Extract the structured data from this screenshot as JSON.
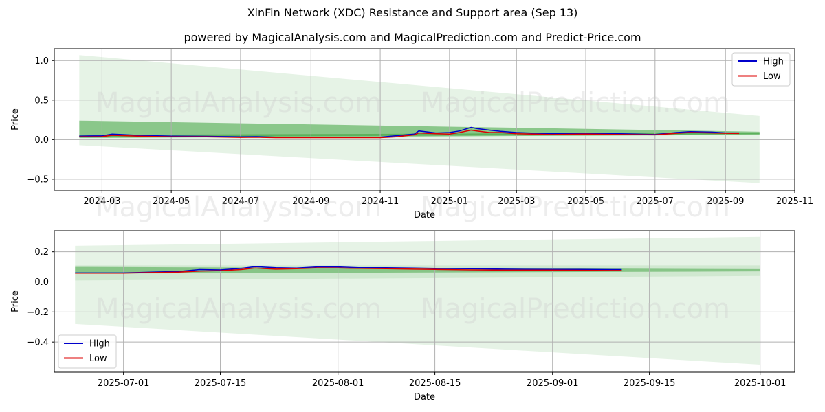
{
  "header": {
    "title": "XinFin Network (XDC) Resistance and Support area (Sep 13)",
    "subtitle": "powered by MagicalAnalysis.com and MagicalPrediction.com and Predict-Price.com"
  },
  "watermark": [
    "MagicalAnalysis.com",
    "MagicalPrediction.com"
  ],
  "colors": {
    "high": "#0000cc",
    "low": "#dd0000",
    "band": "#2e9b2e"
  },
  "chart_data": [
    {
      "type": "line",
      "xlabel": "Date",
      "ylabel": "Price",
      "x_tick_labels": [
        "2024-03",
        "2024-05",
        "2024-07",
        "2024-09",
        "2024-11",
        "2025-01",
        "2025-03",
        "2025-05",
        "2025-07",
        "2025-09",
        "2025-11"
      ],
      "x_tick_dates": [
        "2024-03-01",
        "2024-05-01",
        "2024-07-01",
        "2024-09-01",
        "2024-11-01",
        "2025-01-01",
        "2025-03-01",
        "2025-05-01",
        "2025-07-01",
        "2025-09-01",
        "2025-11-01"
      ],
      "y_ticks": [
        1.0,
        0.5,
        0.0,
        -0.5
      ],
      "y_tick_labels": [
        "1.0",
        "0.5",
        "0.0",
        "−0.5"
      ],
      "xlim": [
        "2024-01-19",
        "2025-11-01"
      ],
      "ylim": [
        -0.64,
        1.15
      ],
      "grid": true,
      "legend": {
        "position": "top-right",
        "entries": [
          "High",
          "Low"
        ]
      },
      "bands": [
        {
          "start": "2024-02-10",
          "end": "2025-10-01",
          "upper": [
            1.07,
            0.3
          ],
          "lower": [
            -0.07,
            -0.55
          ],
          "opacity": 0.12
        },
        {
          "start": "2024-02-10",
          "end": "2025-10-01",
          "upper": [
            0.24,
            0.1
          ],
          "lower": [
            0.02,
            0.06
          ],
          "opacity": 0.5
        },
        {
          "start": "2024-02-10",
          "end": "2025-10-01",
          "upper": [
            0.06,
            0.09
          ],
          "lower": [
            0.03,
            0.07
          ],
          "opacity": 0.5
        }
      ],
      "series": [
        {
          "name": "High",
          "x": [
            "2024-02-10",
            "2024-03-01",
            "2024-03-10",
            "2024-04-01",
            "2024-05-01",
            "2024-06-01",
            "2024-07-01",
            "2024-07-15",
            "2024-08-01",
            "2024-09-01",
            "2024-10-01",
            "2024-11-01",
            "2024-11-15",
            "2024-12-01",
            "2024-12-05",
            "2024-12-20",
            "2025-01-01",
            "2025-01-10",
            "2025-01-20",
            "2025-01-25",
            "2025-02-05",
            "2025-02-15",
            "2025-03-01",
            "2025-04-01",
            "2025-05-01",
            "2025-06-01",
            "2025-07-01",
            "2025-07-20",
            "2025-08-01",
            "2025-08-20",
            "2025-09-01",
            "2025-09-13"
          ],
          "values": [
            0.045,
            0.048,
            0.07,
            0.055,
            0.045,
            0.042,
            0.035,
            0.038,
            0.032,
            0.03,
            0.03,
            0.032,
            0.05,
            0.07,
            0.11,
            0.085,
            0.09,
            0.11,
            0.155,
            0.14,
            0.12,
            0.105,
            0.09,
            0.075,
            0.08,
            0.075,
            0.065,
            0.09,
            0.1,
            0.095,
            0.085,
            0.085
          ]
        },
        {
          "name": "Low",
          "x": [
            "2024-02-10",
            "2024-03-01",
            "2024-03-10",
            "2024-04-01",
            "2024-05-01",
            "2024-06-01",
            "2024-07-01",
            "2024-07-15",
            "2024-08-01",
            "2024-09-01",
            "2024-10-01",
            "2024-11-01",
            "2024-11-15",
            "2024-12-01",
            "2024-12-05",
            "2024-12-20",
            "2025-01-01",
            "2025-01-10",
            "2025-01-20",
            "2025-01-25",
            "2025-02-05",
            "2025-02-15",
            "2025-03-01",
            "2025-04-01",
            "2025-05-01",
            "2025-06-01",
            "2025-07-01",
            "2025-07-20",
            "2025-08-01",
            "2025-08-20",
            "2025-09-01",
            "2025-09-13"
          ],
          "values": [
            0.035,
            0.038,
            0.055,
            0.045,
            0.035,
            0.035,
            0.028,
            0.03,
            0.025,
            0.025,
            0.025,
            0.025,
            0.035,
            0.06,
            0.085,
            0.075,
            0.07,
            0.09,
            0.12,
            0.11,
            0.09,
            0.09,
            0.075,
            0.065,
            0.07,
            0.065,
            0.06,
            0.08,
            0.09,
            0.085,
            0.08,
            0.078
          ]
        }
      ]
    },
    {
      "type": "line",
      "xlabel": "Date",
      "ylabel": "Price",
      "x_tick_labels": [
        "2025-07-01",
        "2025-07-15",
        "2025-08-01",
        "2025-08-15",
        "2025-09-01",
        "2025-09-15",
        "2025-10-01"
      ],
      "x_tick_dates": [
        "2025-07-01",
        "2025-07-15",
        "2025-08-01",
        "2025-08-15",
        "2025-09-01",
        "2025-09-15",
        "2025-10-01"
      ],
      "y_ticks": [
        0.2,
        0.0,
        -0.2,
        -0.4
      ],
      "y_tick_labels": [
        "0.2",
        "0.0",
        "−0.2",
        "−0.4"
      ],
      "xlim": [
        "2025-06-21",
        "2025-10-06"
      ],
      "ylim": [
        -0.6,
        0.34
      ],
      "grid": true,
      "legend": {
        "position": "bottom-left",
        "entries": [
          "High",
          "Low"
        ]
      },
      "bands": [
        {
          "start": "2025-06-24",
          "end": "2025-10-01",
          "upper": [
            0.24,
            0.3
          ],
          "lower": [
            -0.28,
            -0.55
          ],
          "opacity": 0.12
        },
        {
          "start": "2025-06-24",
          "end": "2025-10-01",
          "upper": [
            0.11,
            0.11
          ],
          "lower": [
            0.01,
            0.04
          ],
          "opacity": 0.12
        },
        {
          "start": "2025-06-24",
          "end": "2025-10-01",
          "upper": [
            0.1,
            0.085
          ],
          "lower": [
            0.055,
            0.07
          ],
          "opacity": 0.45
        }
      ],
      "series": [
        {
          "name": "High",
          "x": [
            "2025-06-24",
            "2025-06-28",
            "2025-07-01",
            "2025-07-05",
            "2025-07-09",
            "2025-07-12",
            "2025-07-15",
            "2025-07-18",
            "2025-07-20",
            "2025-07-23",
            "2025-07-26",
            "2025-07-29",
            "2025-08-01",
            "2025-08-04",
            "2025-08-08",
            "2025-08-12",
            "2025-08-15",
            "2025-08-20",
            "2025-08-25",
            "2025-09-01",
            "2025-09-05",
            "2025-09-11"
          ],
          "values": [
            0.06,
            0.06,
            0.06,
            0.065,
            0.07,
            0.082,
            0.08,
            0.09,
            0.102,
            0.095,
            0.092,
            0.1,
            0.1,
            0.095,
            0.095,
            0.092,
            0.09,
            0.088,
            0.085,
            0.083,
            0.083,
            0.082
          ]
        },
        {
          "name": "Low",
          "x": [
            "2025-06-24",
            "2025-06-28",
            "2025-07-01",
            "2025-07-05",
            "2025-07-09",
            "2025-07-12",
            "2025-07-15",
            "2025-07-18",
            "2025-07-20",
            "2025-07-23",
            "2025-07-26",
            "2025-07-29",
            "2025-08-01",
            "2025-08-04",
            "2025-08-08",
            "2025-08-12",
            "2025-08-15",
            "2025-08-20",
            "2025-08-25",
            "2025-09-01",
            "2025-09-05",
            "2025-09-11"
          ],
          "values": [
            0.058,
            0.058,
            0.058,
            0.062,
            0.065,
            0.072,
            0.075,
            0.082,
            0.092,
            0.085,
            0.088,
            0.093,
            0.092,
            0.09,
            0.088,
            0.085,
            0.083,
            0.08,
            0.078,
            0.078,
            0.077,
            0.076
          ]
        }
      ]
    }
  ]
}
